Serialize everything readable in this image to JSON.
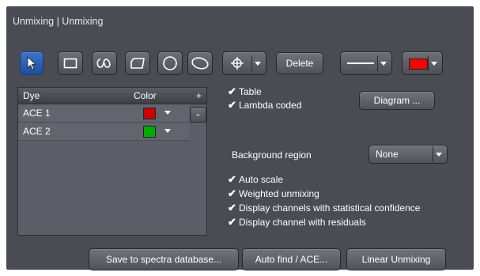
{
  "window": {
    "title": "Unmixing | Unmixing"
  },
  "toolbar": {
    "tools": [
      {
        "name": "pointer-tool",
        "icon": "arrow-pointer-icon",
        "active": true
      },
      {
        "name": "rectangle-tool",
        "icon": "rectangle-icon"
      },
      {
        "name": "freehand-tool",
        "icon": "freehand-spline-icon"
      },
      {
        "name": "polygon-tool",
        "icon": "polygon-icon"
      },
      {
        "name": "circle-tool",
        "icon": "circle-icon"
      },
      {
        "name": "ellipse-tool",
        "icon": "ellipse-icon"
      }
    ],
    "crosshair_icon": "crosshair-icon",
    "delete_label": "Delete",
    "line_style_icon": "line-style-icon",
    "color_value": "#ff0000"
  },
  "dye_table": {
    "headers": {
      "dye": "Dye",
      "color": "Color",
      "add": "+"
    },
    "remove_label": "-",
    "rows": [
      {
        "dye": "ACE 1",
        "color": "#cc0000"
      },
      {
        "dye": "ACE 2",
        "color": "#00aa00"
      }
    ]
  },
  "options": {
    "table_label": "Table",
    "table_checked": true,
    "lambda_label": "Lambda coded",
    "lambda_checked": true,
    "diagram_button": "Diagram ...",
    "background_label": "Background region",
    "background_value": "None",
    "checks": [
      {
        "label": "Auto scale",
        "checked": true
      },
      {
        "label": "Weighted unmixing",
        "checked": true
      },
      {
        "label": "Display channels with statistical confidence",
        "checked": true
      },
      {
        "label": "Display channel with residuals",
        "checked": true
      }
    ]
  },
  "footer": {
    "save_label": "Save to spectra database...",
    "auto_find_label": "Auto find / ACE...",
    "linear_label": "Linear Unmixing"
  }
}
